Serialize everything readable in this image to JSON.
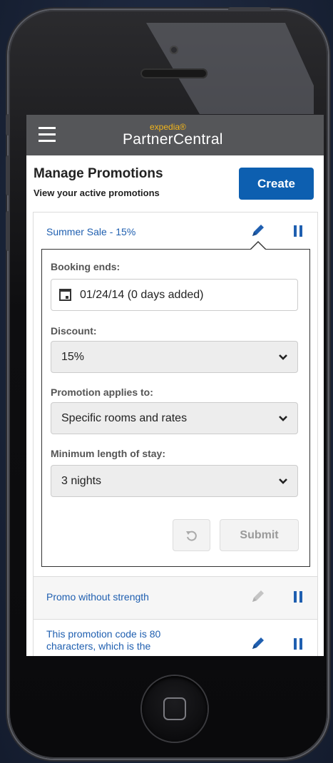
{
  "app": {
    "brand_small": "expedia®",
    "brand_name": "PartnerCentral"
  },
  "header": {
    "title": "Manage Promotions",
    "subtitle": "View your active promotions",
    "create_label": "Create"
  },
  "promotions": [
    {
      "name": "Summer Sale - 15%",
      "edit_enabled": true
    },
    {
      "name": "Promo without strength",
      "edit_enabled": false
    },
    {
      "name_line1": "This promotion code is 80",
      "name_line2": "characters, which is the",
      "edit_enabled": true
    }
  ],
  "edit_form": {
    "booking_ends_label": "Booking ends:",
    "booking_ends_value": "01/24/14 (0 days added)",
    "discount_label": "Discount:",
    "discount_value": "15%",
    "applies_label": "Promotion applies to:",
    "applies_value": "Specific rooms and rates",
    "min_stay_label": "Minimum length of stay:",
    "min_stay_value": "3 nights",
    "submit_label": "Submit"
  },
  "colors": {
    "accent_blue": "#0d5fb0",
    "link_blue": "#1f5fb0",
    "topbar_gray": "#555659",
    "brand_yellow": "#f2b51a"
  },
  "icons": [
    "menu-icon",
    "pencil-icon",
    "pause-icon",
    "calendar-icon",
    "chevron-down-icon",
    "undo-icon"
  ]
}
